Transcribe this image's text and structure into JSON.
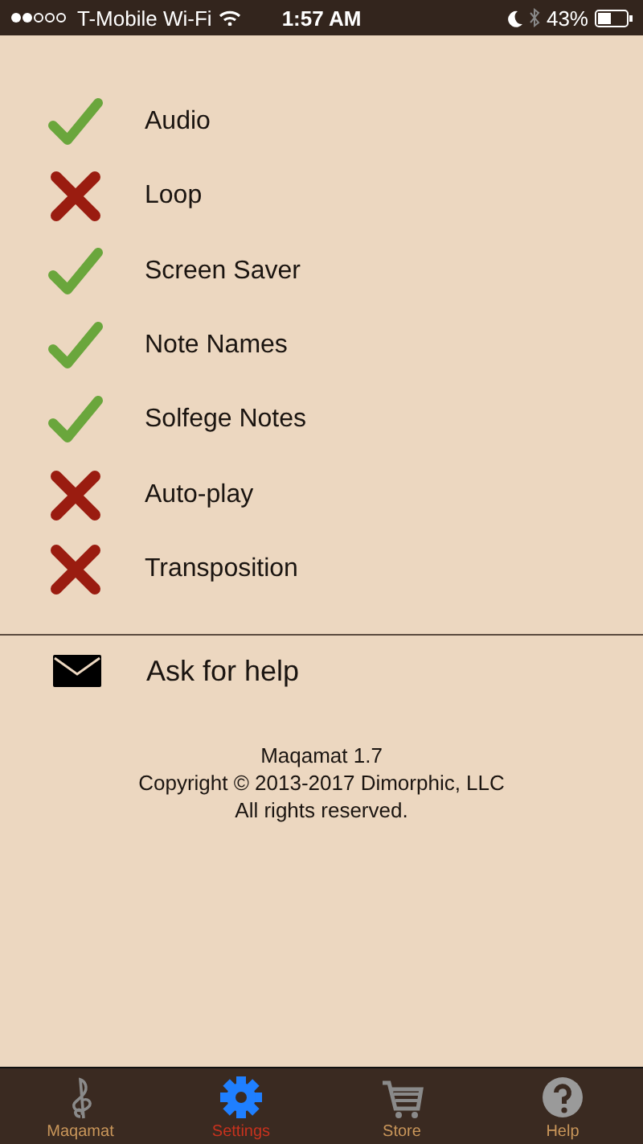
{
  "status_bar": {
    "carrier": "T-Mobile Wi-Fi",
    "time": "1:57 AM",
    "battery": "43%"
  },
  "settings": [
    {
      "label": "Audio",
      "checked": true
    },
    {
      "label": "Loop",
      "checked": false
    },
    {
      "label": "Screen Saver",
      "checked": true
    },
    {
      "label": "Note Names",
      "checked": true
    },
    {
      "label": "Solfege Notes",
      "checked": true
    },
    {
      "label": "Auto-play",
      "checked": false
    },
    {
      "label": "Transposition",
      "checked": false
    }
  ],
  "help_link": {
    "label": "Ask for help"
  },
  "about": [
    "Maqamat 1.7",
    "Copyright © 2013-2017 Dimorphic, LLC",
    "All rights reserved."
  ],
  "tabs": [
    {
      "label": "Maqamat",
      "kind": "clef",
      "selected": false
    },
    {
      "label": "Settings",
      "kind": "gear",
      "selected": true
    },
    {
      "label": "Store",
      "kind": "cart",
      "selected": false
    },
    {
      "label": "Help",
      "kind": "help",
      "selected": false
    }
  ]
}
